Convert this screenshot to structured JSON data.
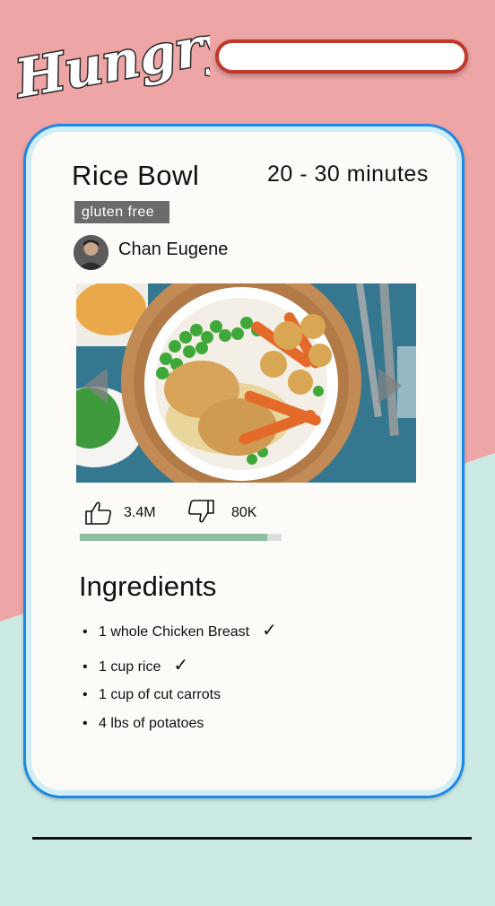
{
  "app": {
    "logo_text": "Hungry",
    "search": {
      "value": "",
      "placeholder": ""
    }
  },
  "colors": {
    "top_background": "#eea5a5",
    "bottom_background": "#cceae4",
    "card_border": "#1e88e5",
    "search_border": "#c0392b",
    "tag_background": "#6b6b6b",
    "ratio_fill": "#8fbfa3"
  },
  "recipe": {
    "title": "Rice Bowl",
    "time": "20 - 30 minutes",
    "tag": "gluten free",
    "author": "Chan Eugene",
    "image_icon": "food-photo",
    "likes": "3.4M",
    "dislikes": "80K",
    "like_ratio": 0.93
  },
  "ingredients": {
    "heading": "Ingredients",
    "items": [
      {
        "text": "1 whole Chicken Breast",
        "checked": true
      },
      {
        "text": "1 cup rice",
        "checked": true
      },
      {
        "text": "1 cup of cut carrots",
        "checked": false
      },
      {
        "text": "4 lbs of potatoes",
        "checked": false
      }
    ]
  },
  "icons": {
    "like": "thumbs-up-icon",
    "dislike": "thumbs-down-icon",
    "prev": "arrow-left-icon",
    "next": "arrow-right-icon",
    "check": "checkmark-icon"
  }
}
